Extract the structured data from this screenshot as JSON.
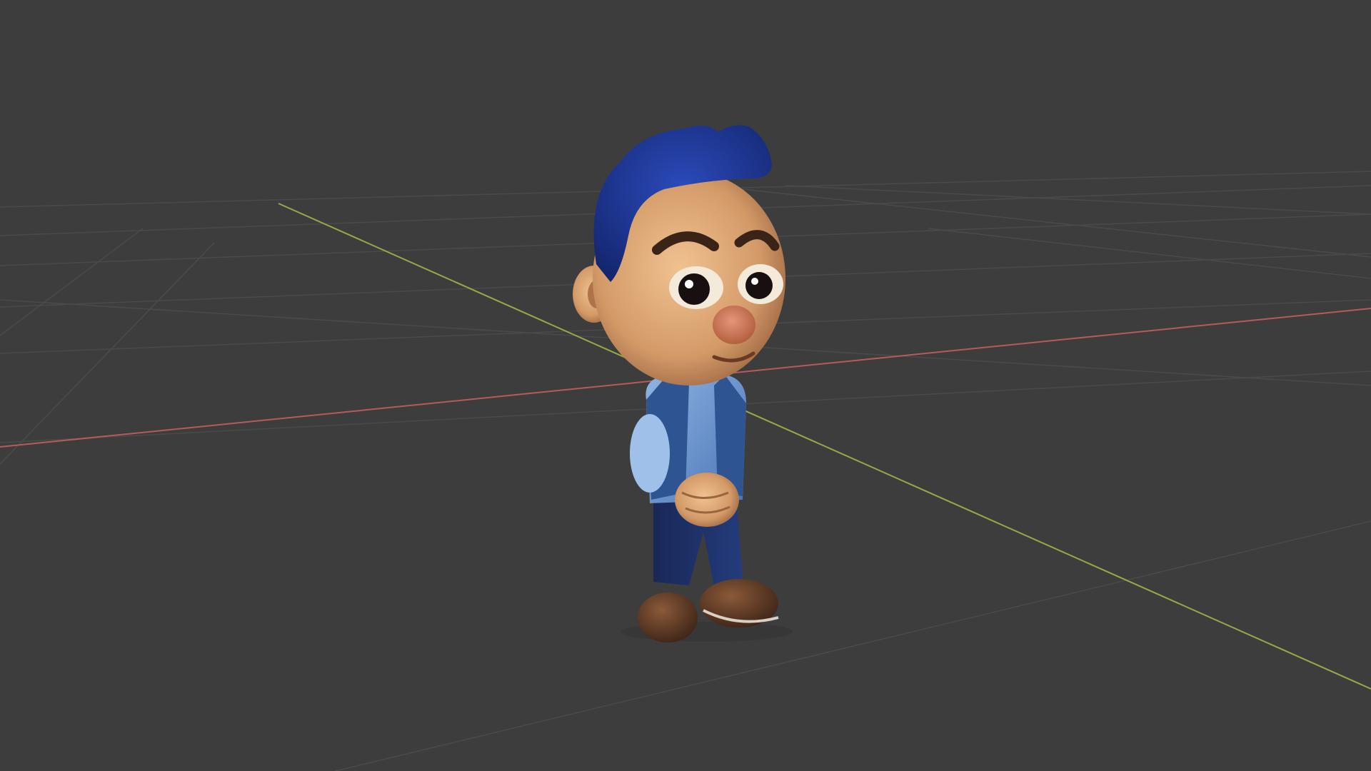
{
  "viewport": {
    "background": "#3d3d3d",
    "grid_color": "#4a4a4a",
    "x_axis_color": "#c35a5a",
    "y_axis_color": "#9ab04a"
  },
  "model": {
    "name": "cartoon-boy-character",
    "hair_color": "#1f3a9e",
    "skin_color": "#d9a274",
    "shirt_color": "#5e88c8",
    "vest_color": "#2a4f8c",
    "pants_color": "#1c2f66",
    "boot_color": "#5a3523"
  }
}
